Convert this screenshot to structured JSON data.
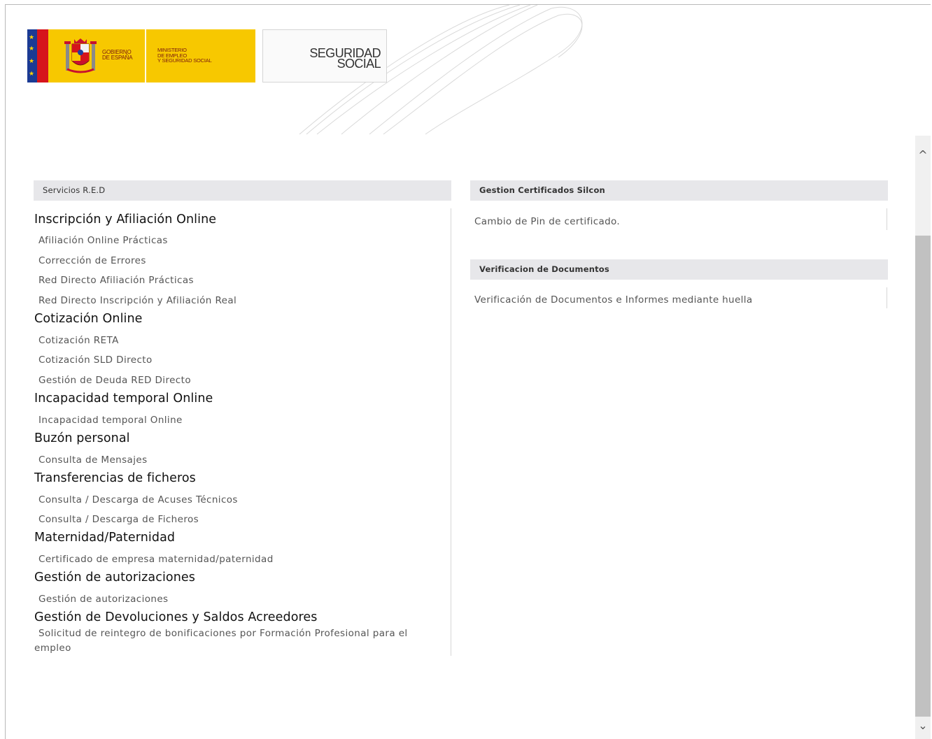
{
  "header": {
    "gobierno_line1": "GOBIERNO",
    "gobierno_line2": "DE ESPAÑA",
    "ministerio_line1": "MINISTERIO",
    "ministerio_line2": "DE EMPLEO",
    "ministerio_line3": "Y SEGURIDAD SOCIAL",
    "ss_line1": "SEGURIDAD",
    "ss_line2": "SOCIAL"
  },
  "left_panel": {
    "title": "Servicios R.E.D",
    "groups": [
      {
        "title": "Inscripción y Afiliación Online",
        "items": [
          "Afiliación Online Prácticas",
          "Corrección de Errores",
          "Red Directo Afiliación Prácticas",
          "Red Directo Inscripción y Afiliación Real"
        ]
      },
      {
        "title": "Cotización Online",
        "items": [
          "Cotización RETA",
          "Cotización SLD Directo",
          "Gestión de Deuda RED Directo"
        ]
      },
      {
        "title": "Incapacidad temporal Online",
        "items": [
          "Incapacidad temporal Online"
        ]
      },
      {
        "title": "Buzón personal",
        "items": [
          "Consulta de Mensajes"
        ]
      },
      {
        "title": "Transferencias de ficheros",
        "items": [
          "Consulta / Descarga de Acuses Técnicos",
          "Consulta / Descarga de Ficheros"
        ]
      },
      {
        "title": "Maternidad/Paternidad",
        "items": [
          "Certificado de empresa maternidad/paternidad"
        ]
      },
      {
        "title": "Gestión de autorizaciones",
        "items": [
          "Gestión de autorizaciones"
        ]
      },
      {
        "title": "Gestión de Devoluciones y Saldos Acreedores",
        "items": [
          "Solicitud de reintegro de bonificaciones por Formación Profesional para el empleo"
        ]
      }
    ]
  },
  "right_panel": {
    "cert_title": "Gestion Certificados Silcon",
    "cert_item": "Cambio de Pin de certificado.",
    "verif_title": "Verificacion de Documentos",
    "verif_item": "Verificación de Documentos e Informes mediante huella"
  },
  "colors": {
    "header_bg": "#e7e7ea",
    "gob_yellow": "#f7c800",
    "link_gray": "#555555"
  },
  "icons": {
    "scroll_up": "^",
    "scroll_down": "⌄"
  }
}
